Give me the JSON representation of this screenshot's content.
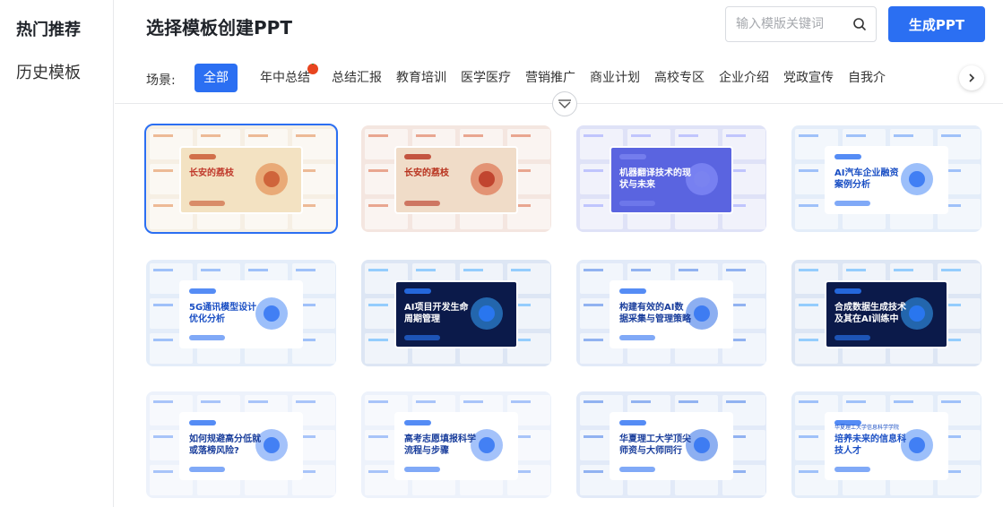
{
  "sidebar": {
    "items": [
      {
        "label": "热门推荐",
        "active": true
      },
      {
        "label": "历史模板",
        "active": false
      }
    ]
  },
  "header": {
    "title": "选择模板创建PPT",
    "search_placeholder": "输入模版关键词",
    "generate_label": "生成PPT"
  },
  "filters": {
    "scene_label": "场景:",
    "tabs": [
      {
        "label": "全部",
        "active": true
      },
      {
        "label": "年中总结",
        "hot": true
      },
      {
        "label": "总结汇报"
      },
      {
        "label": "教育培训"
      },
      {
        "label": "医学医疗"
      },
      {
        "label": "营销推广"
      },
      {
        "label": "商业计划"
      },
      {
        "label": "高校专区"
      },
      {
        "label": "企业介绍"
      },
      {
        "label": "党政宣传"
      },
      {
        "label": "自我介"
      }
    ]
  },
  "templates": [
    {
      "title": "长安的荔枝",
      "theme": "warm-light",
      "selected": true
    },
    {
      "title": "长安的荔枝",
      "theme": "red"
    },
    {
      "title": "机器翻译技术的现状与未来",
      "theme": "purple"
    },
    {
      "title": "AI汽车企业融资案例分析",
      "theme": "blue-light"
    },
    {
      "title": "5G通讯模型设计优化分析",
      "theme": "blue-light"
    },
    {
      "title": "AI项目开发生命周期管理",
      "theme": "dark"
    },
    {
      "title": "构建有效的AI数据采集与管理策略",
      "theme": "blue"
    },
    {
      "title": "合成数据生成技术及其在AI训练中的应用",
      "theme": "dark"
    },
    {
      "title": "如何规避高分低就或落榜风险?",
      "theme": "light"
    },
    {
      "title": "高考志愿填报科学流程与步骤",
      "theme": "light"
    },
    {
      "title": "华夏理工大学顶尖师资与大师同行",
      "theme": "blue"
    },
    {
      "title": "培养未来的信息科技人才",
      "theme": "blue-light",
      "subtitle": "华夏理工大学信息科学学院"
    }
  ],
  "colors": {
    "accent": "#2b6ff2",
    "hot": "#e8451f"
  },
  "icons": {
    "search": "search-icon",
    "next": "chevron-right-icon",
    "collapse": "chevron-down-icon"
  }
}
